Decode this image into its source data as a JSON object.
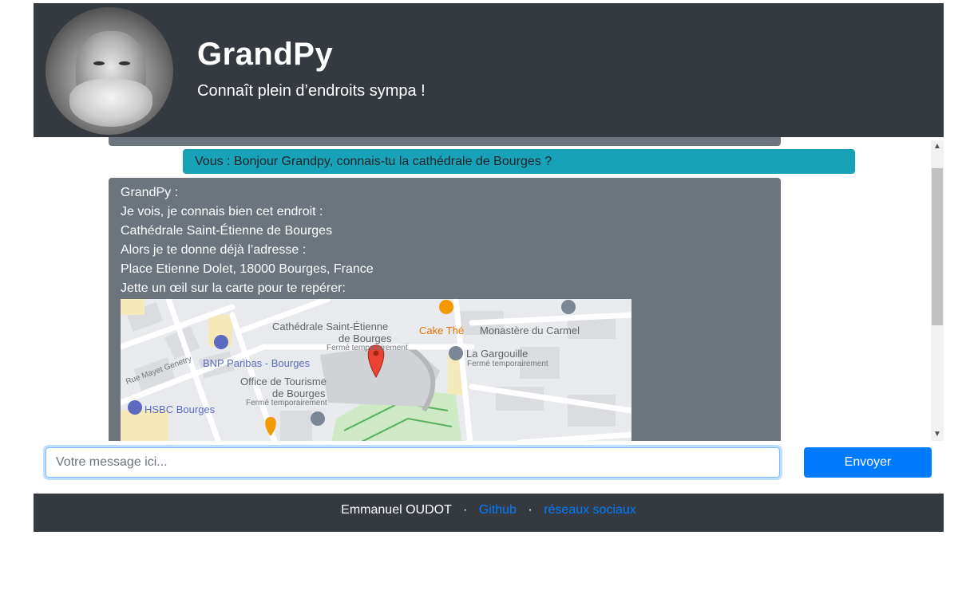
{
  "header": {
    "title": "GrandPy",
    "subtitle": "Connaît plein d’endroits sympa !"
  },
  "chat": {
    "user_message": "Vous : Bonjour Grandpy, connais-tu la cathédrale de Bourges ?",
    "bot_lines": [
      "GrandPy :",
      "Je vois, je connais bien cet endroit :",
      "Cathédrale Saint-Étienne de Bourges",
      "Alors je te donne déjà l’adresse :",
      "Place Etienne Dolet, 18000 Bourges, France",
      "Jette un œil sur la carte pour te repérer:"
    ],
    "map_labels": {
      "cathedral_line1": "Cathédrale Saint-Étienne",
      "cathedral_line2": "de Bourges",
      "cathedral_status": "Fermé temporairement",
      "cake": "Cake Thé",
      "monastere": "Monastère du Carmel",
      "gargouille": "La Gargouille",
      "gargouille_status": "Fermé temporairement",
      "bnp": "BNP Paribas - Bourges",
      "street": "Rue Mayet Genetry",
      "office_line1": "Office de Tourisme",
      "office_line2": "de Bourges",
      "office_status": "Fermé temporairement",
      "hsbc": "HSBC Bourges"
    }
  },
  "input": {
    "placeholder": "Votre message ici..."
  },
  "send_button": "Envoyer",
  "footer": {
    "author": "Emmanuel OUDOT",
    "separator": "·",
    "github": "Github",
    "social": "réseaux sociaux"
  },
  "colors": {
    "header_bg": "#343a40",
    "user_bubble": "#17a2b8",
    "bot_bubble": "#6c757d",
    "button": "#007bff"
  }
}
